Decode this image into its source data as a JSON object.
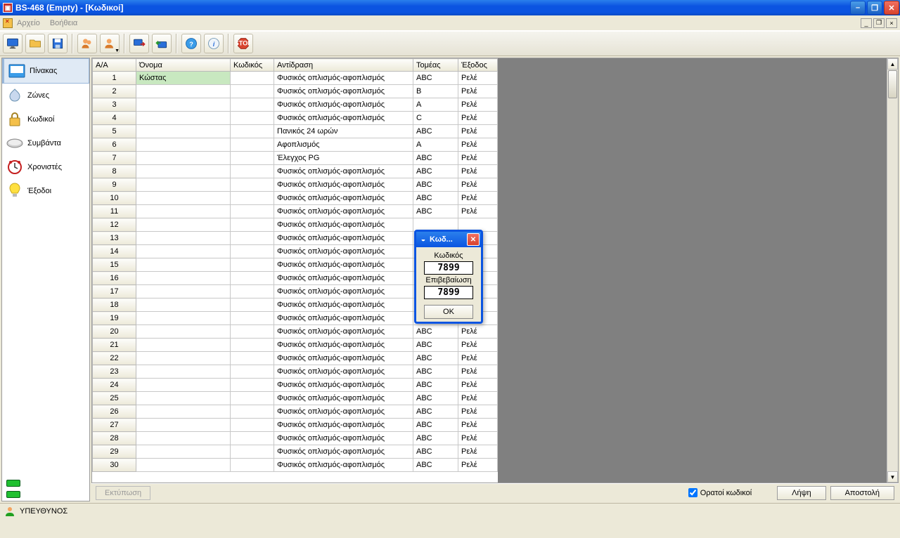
{
  "window": {
    "title": "BS-468 (Empty) - [Κωδικοί]"
  },
  "menu": {
    "file": "Αρχείο",
    "help": "Βοήθεια"
  },
  "sidebar": {
    "items": [
      {
        "label": "Πίνακας"
      },
      {
        "label": "Ζώνες"
      },
      {
        "label": "Κωδικοί"
      },
      {
        "label": "Συμβάντα"
      },
      {
        "label": "Χρονιστές"
      },
      {
        "label": "Έξοδοι"
      }
    ]
  },
  "grid": {
    "headers": {
      "aa": "Α/Α",
      "name": "Όνομα",
      "code": "Κωδικός",
      "react": "Αντίδραση",
      "sector": "Τομέας",
      "exit": "Έξοδος"
    },
    "rows": [
      {
        "aa": "1",
        "name": "Κώστας",
        "code": "",
        "react": "Φυσικός οπλισμός-αφοπλισμός",
        "sector": "ABC",
        "exit": "Ρελέ"
      },
      {
        "aa": "2",
        "name": "",
        "code": "",
        "react": "Φυσικός οπλισμός-αφοπλισμός",
        "sector": "B",
        "exit": "Ρελέ"
      },
      {
        "aa": "3",
        "name": "",
        "code": "",
        "react": "Φυσικός οπλισμός-αφοπλισμός",
        "sector": "A",
        "exit": "Ρελέ"
      },
      {
        "aa": "4",
        "name": "",
        "code": "",
        "react": "Φυσικός οπλισμός-αφοπλισμός",
        "sector": "C",
        "exit": "Ρελέ"
      },
      {
        "aa": "5",
        "name": "",
        "code": "",
        "react": "Πανικός 24 ωρών",
        "sector": "ABC",
        "exit": "Ρελέ"
      },
      {
        "aa": "6",
        "name": "",
        "code": "",
        "react": "Αφοπλισμός",
        "sector": "A",
        "exit": "Ρελέ"
      },
      {
        "aa": "7",
        "name": "",
        "code": "",
        "react": "Έλεγχος PG",
        "sector": "ABC",
        "exit": "Ρελέ"
      },
      {
        "aa": "8",
        "name": "",
        "code": "",
        "react": "Φυσικός οπλισμός-αφοπλισμός",
        "sector": "ABC",
        "exit": "Ρελέ"
      },
      {
        "aa": "9",
        "name": "",
        "code": "",
        "react": "Φυσικός οπλισμός-αφοπλισμός",
        "sector": "ABC",
        "exit": "Ρελέ"
      },
      {
        "aa": "10",
        "name": "",
        "code": "",
        "react": "Φυσικός οπλισμός-αφοπλισμός",
        "sector": "ABC",
        "exit": "Ρελέ"
      },
      {
        "aa": "11",
        "name": "",
        "code": "",
        "react": "Φυσικός οπλισμός-αφοπλισμός",
        "sector": "ABC",
        "exit": "Ρελέ"
      },
      {
        "aa": "12",
        "name": "",
        "code": "",
        "react": "Φυσικός οπλισμός-αφοπλισμός",
        "sector": "",
        "exit": ""
      },
      {
        "aa": "13",
        "name": "",
        "code": "",
        "react": "Φυσικός οπλισμός-αφοπλισμός",
        "sector": "",
        "exit": ""
      },
      {
        "aa": "14",
        "name": "",
        "code": "",
        "react": "Φυσικός οπλισμός-αφοπλισμός",
        "sector": "",
        "exit": ""
      },
      {
        "aa": "15",
        "name": "",
        "code": "",
        "react": "Φυσικός οπλισμός-αφοπλισμός",
        "sector": "",
        "exit": ""
      },
      {
        "aa": "16",
        "name": "",
        "code": "",
        "react": "Φυσικός οπλισμός-αφοπλισμός",
        "sector": "",
        "exit": ""
      },
      {
        "aa": "17",
        "name": "",
        "code": "",
        "react": "Φυσικός οπλισμός-αφοπλισμός",
        "sector": "",
        "exit": ""
      },
      {
        "aa": "18",
        "name": "",
        "code": "",
        "react": "Φυσικός οπλισμός-αφοπλισμός",
        "sector": "",
        "exit": ""
      },
      {
        "aa": "19",
        "name": "",
        "code": "",
        "react": "Φυσικός οπλισμός-αφοπλισμός",
        "sector": "",
        "exit": ""
      },
      {
        "aa": "20",
        "name": "",
        "code": "",
        "react": "Φυσικός οπλισμός-αφοπλισμός",
        "sector": "ABC",
        "exit": "Ρελέ"
      },
      {
        "aa": "21",
        "name": "",
        "code": "",
        "react": "Φυσικός οπλισμός-αφοπλισμός",
        "sector": "ABC",
        "exit": "Ρελέ"
      },
      {
        "aa": "22",
        "name": "",
        "code": "",
        "react": "Φυσικός οπλισμός-αφοπλισμός",
        "sector": "ABC",
        "exit": "Ρελέ"
      },
      {
        "aa": "23",
        "name": "",
        "code": "",
        "react": "Φυσικός οπλισμός-αφοπλισμός",
        "sector": "ABC",
        "exit": "Ρελέ"
      },
      {
        "aa": "24",
        "name": "",
        "code": "",
        "react": "Φυσικός οπλισμός-αφοπλισμός",
        "sector": "ABC",
        "exit": "Ρελέ"
      },
      {
        "aa": "25",
        "name": "",
        "code": "",
        "react": "Φυσικός οπλισμός-αφοπλισμός",
        "sector": "ABC",
        "exit": "Ρελέ"
      },
      {
        "aa": "26",
        "name": "",
        "code": "",
        "react": "Φυσικός οπλισμός-αφοπλισμός",
        "sector": "ABC",
        "exit": "Ρελέ"
      },
      {
        "aa": "27",
        "name": "",
        "code": "",
        "react": "Φυσικός οπλισμός-αφοπλισμός",
        "sector": "ABC",
        "exit": "Ρελέ"
      },
      {
        "aa": "28",
        "name": "",
        "code": "",
        "react": "Φυσικός οπλισμός-αφοπλισμός",
        "sector": "ABC",
        "exit": "Ρελέ"
      },
      {
        "aa": "29",
        "name": "",
        "code": "",
        "react": "Φυσικός οπλισμός-αφοπλισμός",
        "sector": "ABC",
        "exit": "Ρελέ"
      },
      {
        "aa": "30",
        "name": "",
        "code": "",
        "react": "Φυσικός οπλισμός-αφοπλισμός",
        "sector": "ABC",
        "exit": "Ρελέ"
      }
    ]
  },
  "bottom": {
    "print": "Εκτύπωση",
    "visible_codes": "Ορατοί κωδικοί",
    "receive": "Λήψη",
    "send": "Αποστολή"
  },
  "status": {
    "user": "ΥΠΕΥΘΥΝΟΣ"
  },
  "dialog": {
    "title": "Κωδ...",
    "code_label": "Κωδικός",
    "code_value": "7899",
    "confirm_label": "Επιβεβαίωση",
    "confirm_value": "7899",
    "ok": "OK"
  }
}
